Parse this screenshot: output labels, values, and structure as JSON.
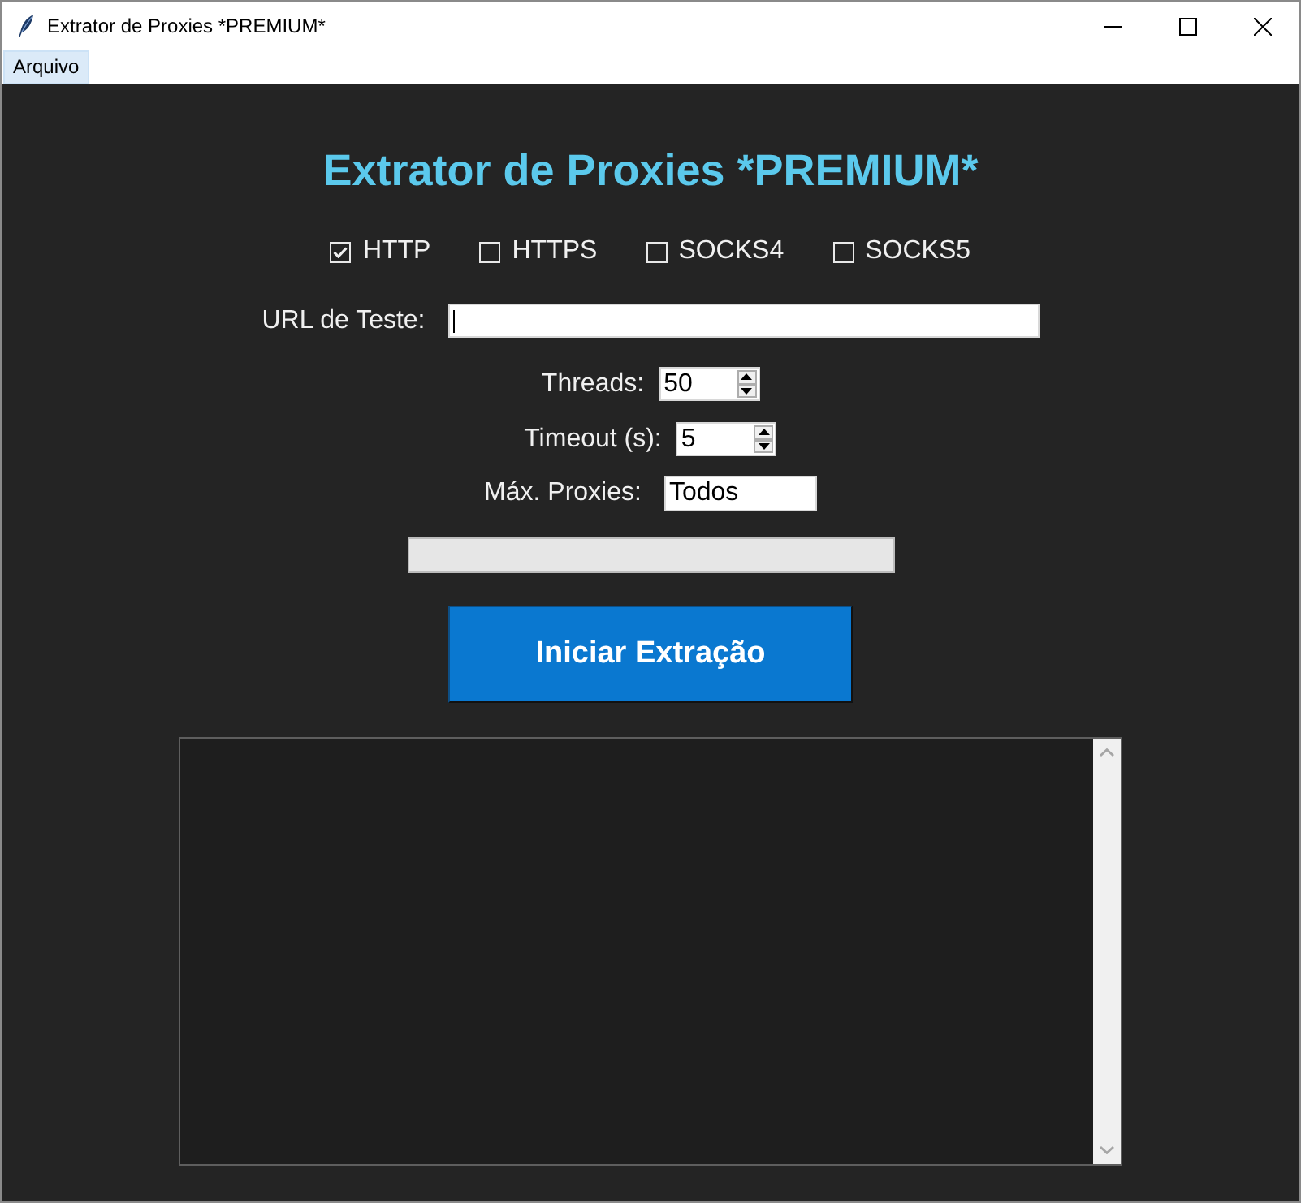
{
  "window": {
    "title": "Extrator de Proxies *PREMIUM*"
  },
  "menu": [
    {
      "label": "Arquivo",
      "selected": true
    }
  ],
  "heading": "Extrator de Proxies *PREMIUM*",
  "protocols": [
    {
      "label": "HTTP",
      "checked": true
    },
    {
      "label": "HTTPS",
      "checked": false
    },
    {
      "label": "SOCKS4",
      "checked": false
    },
    {
      "label": "SOCKS5",
      "checked": false
    }
  ],
  "fields": [
    {
      "kind": "url",
      "label": "URL de Teste:",
      "focused": true
    },
    {
      "kind": "spinbox",
      "label": "Threads:",
      "value": "50"
    },
    {
      "kind": "spinbox",
      "label": "Timeout (s):",
      "value": "5"
    },
    {
      "kind": "entry",
      "label": "Máx. Proxies:",
      "value": "Todos"
    }
  ],
  "start_button": {
    "label": "Iniciar Extração"
  }
}
